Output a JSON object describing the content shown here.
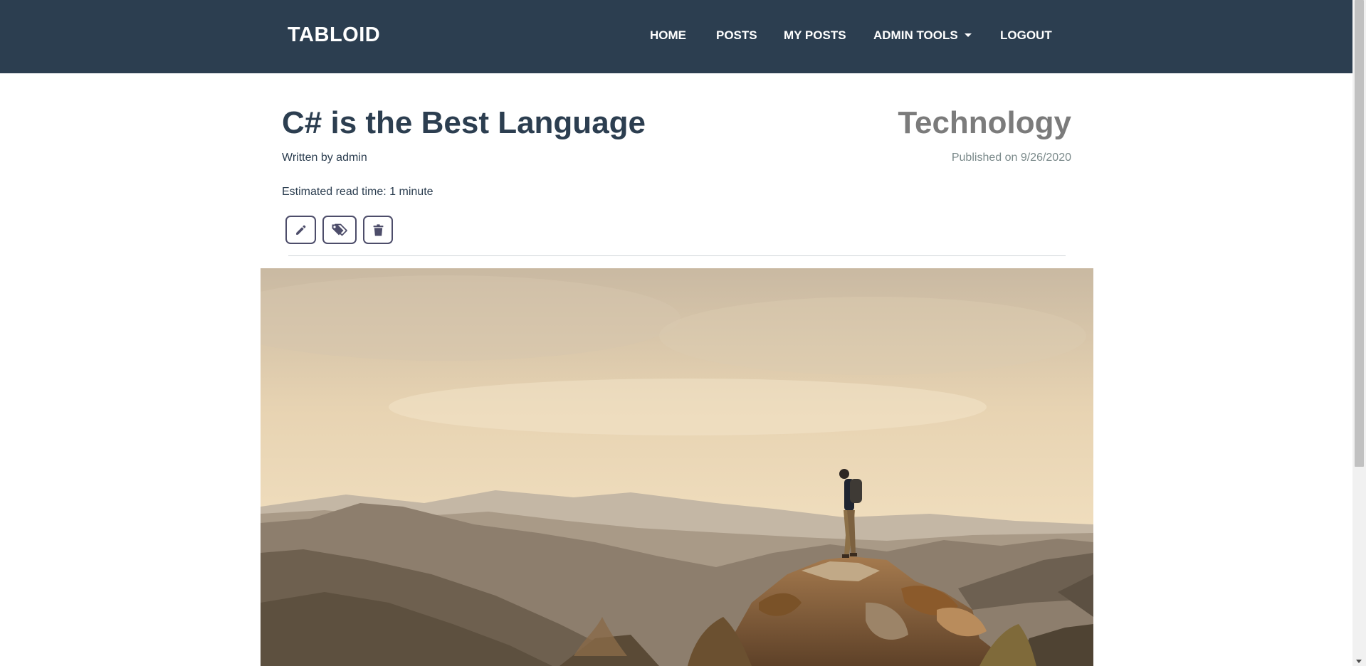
{
  "navbar": {
    "brand": "TABLOID",
    "links": [
      {
        "label": "HOME"
      },
      {
        "label": "POSTS"
      },
      {
        "label": "MY POSTS"
      },
      {
        "label": "ADMIN TOOLS",
        "dropdown": true
      },
      {
        "label": "LOGOUT"
      }
    ]
  },
  "post": {
    "title": "C# is the Best Language",
    "category": "Technology",
    "author_text": "Written by admin",
    "published_text": "Published on 9/26/2020",
    "read_time_text": "Estimated read time: 1 minute",
    "actions": [
      {
        "icon": "pencil-icon"
      },
      {
        "icon": "tags-icon"
      },
      {
        "icon": "trash-icon"
      }
    ]
  },
  "colors": {
    "navbar_bg": "#2c3e50",
    "title": "#2c3e50",
    "category": "#7b7b7b",
    "button_border": "#4d4d6a"
  }
}
